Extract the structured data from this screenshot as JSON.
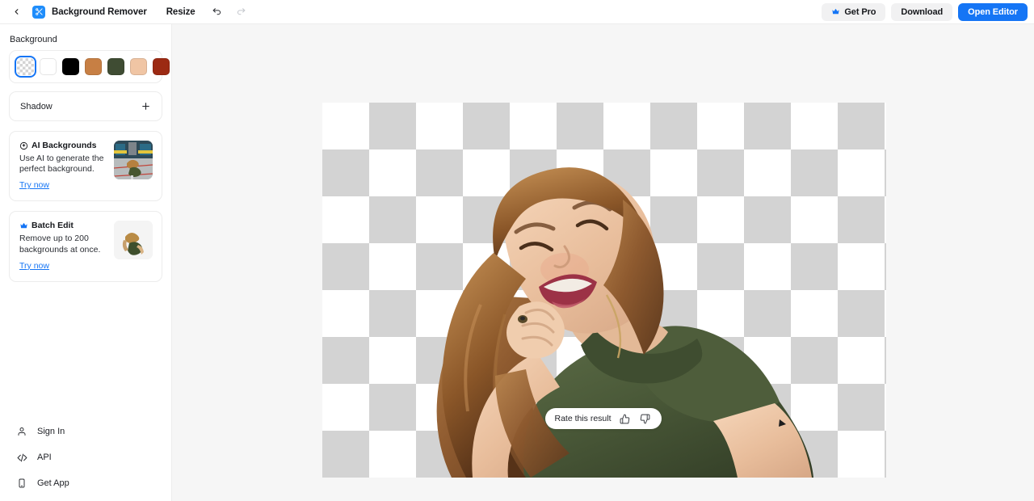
{
  "header": {
    "back_icon": "chevron-left-icon",
    "logo_icon": "app-logo-icon",
    "app_title": "Background Remover",
    "resize_label": "Resize",
    "undo_icon": "undo-icon",
    "redo_icon": "redo-icon",
    "get_pro_label": "Get Pro",
    "get_pro_icon": "crown-icon",
    "download_label": "Download",
    "open_editor_label": "Open Editor",
    "accent_color": "#1575f5"
  },
  "sidebar": {
    "background": {
      "section_label": "Background",
      "swatches": [
        {
          "name": "transparent",
          "color": "transparent",
          "selected": true
        },
        {
          "name": "white",
          "color": "#ffffff",
          "selected": false
        },
        {
          "name": "black",
          "color": "#000000",
          "selected": false
        },
        {
          "name": "tan",
          "color": "#c77f44",
          "selected": false
        },
        {
          "name": "olive",
          "color": "#3f4c33",
          "selected": false
        },
        {
          "name": "peach",
          "color": "#f0c5a4",
          "selected": false
        },
        {
          "name": "brick",
          "color": "#9c2a13",
          "selected": false
        },
        {
          "name": "custom-color",
          "color": "rainbow",
          "selected": false
        }
      ]
    },
    "shadow": {
      "label": "Shadow",
      "add_icon": "plus-icon"
    },
    "promos": [
      {
        "icon": "ai-sparkle-icon",
        "title": "AI Backgrounds",
        "description": "Use AI to generate the perfect background.",
        "link_label": "Try now",
        "thumb": "ai-background-thumbnail"
      },
      {
        "icon": "crown-icon",
        "title": "Batch Edit",
        "description": "Remove up to 200 backgrounds at once.",
        "link_label": "Try now",
        "thumb": "batch-edit-thumbnail"
      }
    ],
    "nav_items": [
      {
        "icon": "person-icon",
        "label": "Sign In"
      },
      {
        "icon": "code-icon",
        "label": "API"
      },
      {
        "icon": "phone-icon",
        "label": "Get App"
      }
    ]
  },
  "canvas": {
    "background_color": "#f6f6f6",
    "checker_light": "#ffffff",
    "checker_dark": "#d3d3d3",
    "subject_alt": "woman in olive green t-shirt leaning on hand, background removed"
  },
  "rate_bar": {
    "label": "Rate this result",
    "thumbs_up_icon": "thumbs-up-icon",
    "thumbs_down_icon": "thumbs-down-icon"
  }
}
